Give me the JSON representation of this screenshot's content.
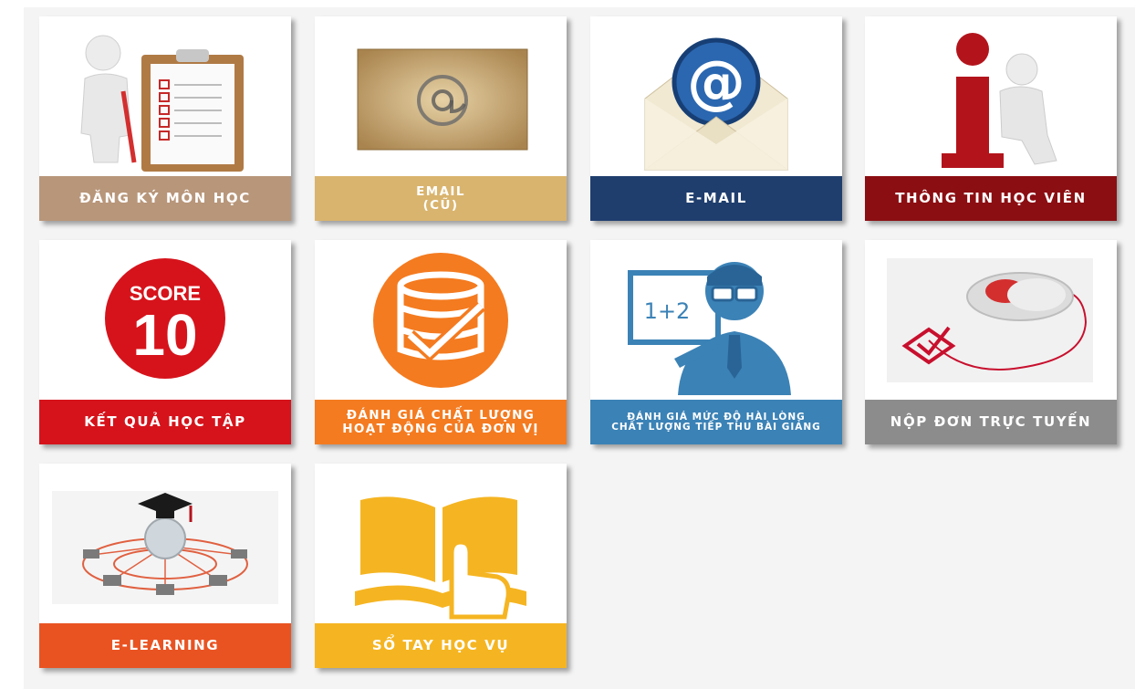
{
  "tiles": [
    {
      "id": "dang-ky-mon-hoc",
      "label": "ĐĂNG KÝ MÔN HỌC",
      "color": "#b8967a",
      "icon": "clipboard-checklist-icon"
    },
    {
      "id": "email-cu",
      "label": "EMAIL\n(CŨ)",
      "color": "#d9b46e",
      "icon": "old-paper-at-sign-icon"
    },
    {
      "id": "e-mail",
      "label": "E-MAIL",
      "color": "#1f3e6e",
      "icon": "envelope-at-sign-icon"
    },
    {
      "id": "thong-tin-hoc-vien",
      "label": "THÔNG TIN HỌC VIÊN",
      "color": "#8b0e12",
      "icon": "info-figure-icon"
    },
    {
      "id": "ket-qua-hoc-tap",
      "label": "KẾT QUẢ HỌC TẬP",
      "color": "#d6131b",
      "icon": "score-10-icon",
      "score_top": "SCORE",
      "score_value": "10"
    },
    {
      "id": "danh-gia-chat-luong",
      "label": "ĐÁNH GIÁ CHẤT LƯỢNG\nHOẠT ĐỘNG CỦA ĐƠN VỊ",
      "color": "#f47b20",
      "icon": "database-check-icon"
    },
    {
      "id": "danh-gia-muc-do",
      "label": "ĐÁNH GIÁ MỨC ĐỘ HÀI LÒNG\nCHẤT LƯỢNG TIẾP THU BÀI GIẢNG",
      "color": "#3b82b6",
      "icon": "teacher-board-icon",
      "board_text": "1+2"
    },
    {
      "id": "nop-don-truc-tuyen",
      "label": "NỘP ĐƠN TRỰC TUYẾN",
      "color": "#8c8c8c",
      "icon": "mouse-checkbox-icon"
    },
    {
      "id": "e-learning",
      "label": "E-LEARNING",
      "color": "#e95322",
      "icon": "globe-network-graduation-icon"
    },
    {
      "id": "so-tay-hoc-vu",
      "label": "SỔ TAY HỌC VỤ",
      "color": "#f5b522",
      "icon": "book-hand-icon"
    }
  ]
}
